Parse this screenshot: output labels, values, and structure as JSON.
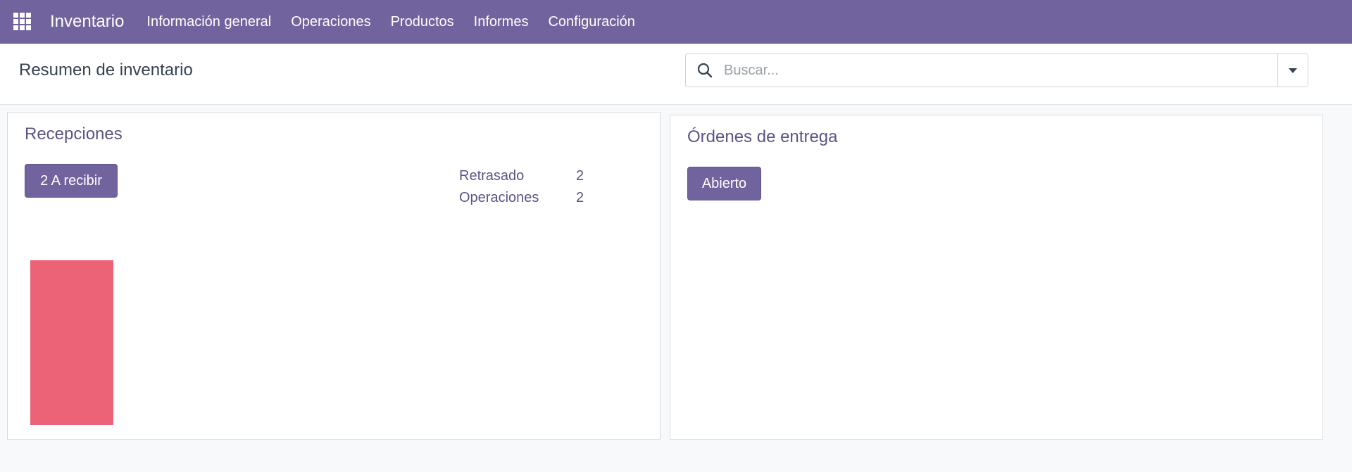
{
  "navbar": {
    "brand": "Inventario",
    "menu": [
      {
        "label": "Información general"
      },
      {
        "label": "Operaciones"
      },
      {
        "label": "Productos"
      },
      {
        "label": "Informes"
      },
      {
        "label": "Configuración"
      }
    ]
  },
  "control_panel": {
    "title": "Resumen de inventario",
    "search": {
      "placeholder": "Buscar...",
      "value": ""
    }
  },
  "cards": {
    "recepciones": {
      "title": "Recepciones",
      "button_label": "2 A recibir",
      "stats": [
        {
          "label": "Retrasado",
          "value": "2"
        },
        {
          "label": "Operaciones",
          "value": "2"
        }
      ],
      "chart_data": {
        "type": "bar",
        "values": [
          1
        ],
        "colors": [
          "#ec6277"
        ]
      }
    },
    "entrega": {
      "title": "Órdenes de entrega",
      "button_label": "Abierto"
    }
  },
  "colors": {
    "navbar": "#71639e",
    "primary": "#71639e",
    "accent_text": "#5e5385",
    "bar": "#ec6277"
  },
  "icons": {
    "apps": "grid-icon",
    "search": "search-icon",
    "toggle": "caret-down-icon"
  }
}
